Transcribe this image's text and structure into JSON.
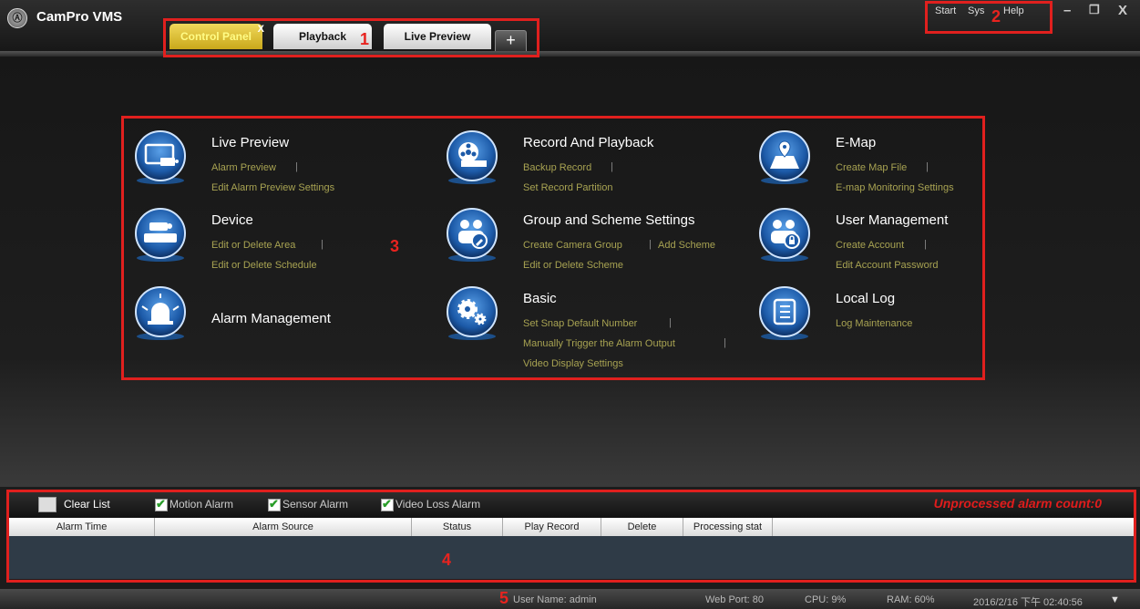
{
  "app": {
    "title": "CamPro VMS"
  },
  "tabs": [
    {
      "label": "Control Panel",
      "close": "X"
    },
    {
      "label": "Playback"
    },
    {
      "label": "Live Preview"
    }
  ],
  "add_tab": "+",
  "menu": {
    "start": "Start",
    "sys": "Sys",
    "help": "Help"
  },
  "window_controls": {
    "minimize": "–",
    "restore": "❐",
    "close": "X"
  },
  "annotations": [
    "1",
    "2",
    "3",
    "4",
    "5"
  ],
  "modules": [
    {
      "title": "Live Preview",
      "icon": "monitor-camera-icon",
      "links": [
        "Alarm Preview",
        "Edit Alarm Preview Settings"
      ]
    },
    {
      "title": "Record And Playback",
      "icon": "film-reel-icon",
      "links": [
        "Backup Record",
        "Set Record Partition"
      ]
    },
    {
      "title": "E-Map",
      "icon": "map-pin-icon",
      "links": [
        "Create Map File",
        "E-map Monitoring Settings"
      ]
    },
    {
      "title": "Device",
      "icon": "nvr-device-icon",
      "links": [
        "Edit or Delete Area",
        "Edit or Delete Schedule"
      ]
    },
    {
      "title": "Group and Scheme Settings",
      "icon": "group-edit-icon",
      "links": [
        "Create Camera Group",
        "Add Scheme",
        "Edit or Delete Scheme"
      ]
    },
    {
      "title": "User Management",
      "icon": "user-lock-icon",
      "links": [
        "Create Account",
        "Edit Account Password"
      ]
    },
    {
      "title": "Alarm Management",
      "icon": "alarm-siren-icon",
      "links": []
    },
    {
      "title": "Basic",
      "icon": "gears-icon",
      "links": [
        "Set Snap Default Number",
        "Manually Trigger the Alarm Output",
        "Video Display Settings"
      ]
    },
    {
      "title": "Local Log",
      "icon": "log-list-icon",
      "links": [
        "Log Maintenance"
      ]
    }
  ],
  "alarm_panel": {
    "clear_list": "Clear List",
    "filters": [
      "Motion Alarm",
      "Sensor Alarm",
      "Video Loss Alarm"
    ],
    "unprocessed": "Unprocessed alarm count:0",
    "columns": [
      "Alarm Time",
      "Alarm Source",
      "Status",
      "Play Record",
      "Delete",
      "Processing stat"
    ]
  },
  "status_bar": {
    "user": "User Name: admin",
    "web_port": "Web Port: 80",
    "cpu": "CPU: 9%",
    "ram": "RAM: 60%",
    "datetime": "2016/2/16 下午 02:40:56"
  },
  "colors": {
    "annotation_red": "#e0201e",
    "link_olive": "#a8a352",
    "tab_active": "#e8c93a"
  }
}
